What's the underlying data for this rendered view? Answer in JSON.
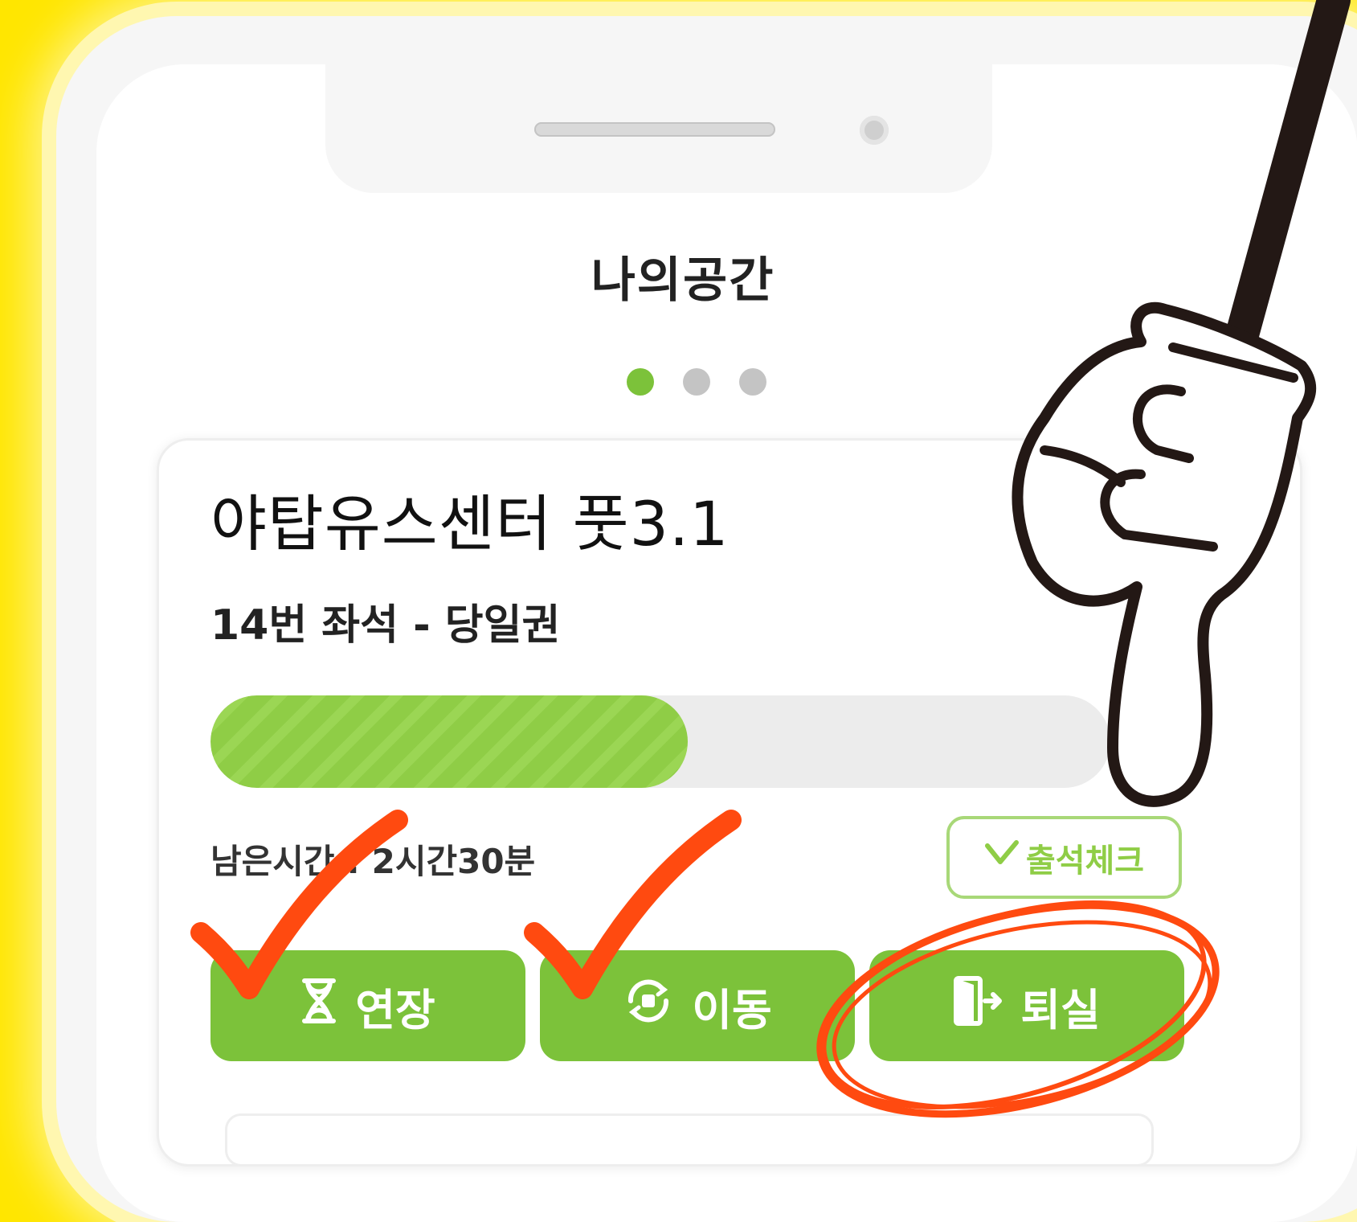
{
  "screen": {
    "title": "나의공간",
    "page_dots": {
      "count": 3,
      "active": 1
    }
  },
  "seat_card": {
    "facility_name": "야탑유스센터 풋3.1",
    "seat_info": "14번 좌석 - 당일권",
    "progress_fraction": 0.53,
    "remaining_time": "남은시간 : 2시간30분",
    "checkin_label": "출석체크"
  },
  "actions": {
    "extend_label": "연장",
    "move_label": "이동",
    "leave_label": "퇴실"
  },
  "colors": {
    "background": "#ffe600",
    "accent_green": "#7cc23a",
    "annotation_red": "#ff4a10"
  },
  "icons": {
    "extend": "hourglass-icon",
    "move": "swap-seat-icon",
    "leave": "exit-door-icon",
    "check": "check-icon"
  }
}
